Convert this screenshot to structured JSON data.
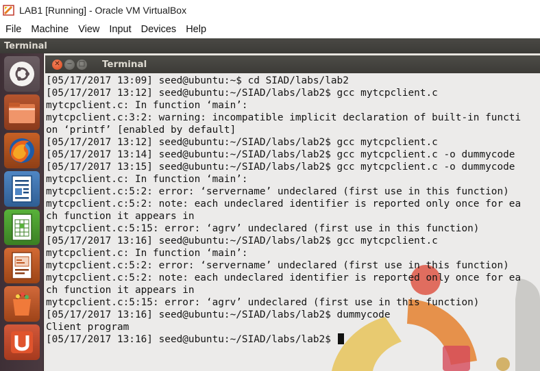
{
  "host": {
    "window_title": "LAB1 [Running] - Oracle VM VirtualBox",
    "menu": [
      "File",
      "Machine",
      "View",
      "Input",
      "Devices",
      "Help"
    ]
  },
  "guest": {
    "panel_title": "Terminal",
    "launcher": [
      {
        "name": "ubuntu-dash-icon"
      },
      {
        "name": "files-icon"
      },
      {
        "name": "firefox-icon"
      },
      {
        "name": "libreoffice-writer-icon"
      },
      {
        "name": "libreoffice-calc-icon"
      },
      {
        "name": "libreoffice-impress-icon"
      },
      {
        "name": "software-center-icon"
      },
      {
        "name": "ubuntu-one-icon"
      }
    ],
    "terminal": {
      "title": "Terminal",
      "lines": [
        "[05/17/2017 13:09] seed@ubuntu:~$ cd SIAD/labs/lab2",
        "[05/17/2017 13:12] seed@ubuntu:~/SIAD/labs/lab2$ gcc mytcpclient.c",
        "mytcpclient.c: In function ‘main’:",
        "mytcpclient.c:3:2: warning: incompatible implicit declaration of built-in functi",
        "on ‘printf’ [enabled by default]",
        "[05/17/2017 13:12] seed@ubuntu:~/SIAD/labs/lab2$ gcc mytcpclient.c",
        "[05/17/2017 13:14] seed@ubuntu:~/SIAD/labs/lab2$ gcc mytcpclient.c -o dummycode",
        "[05/17/2017 13:15] seed@ubuntu:~/SIAD/labs/lab2$ gcc mytcpclient.c -o dummycode",
        "mytcpclient.c: In function ‘main’:",
        "mytcpclient.c:5:2: error: ‘servername’ undeclared (first use in this function)",
        "mytcpclient.c:5:2: note: each undeclared identifier is reported only once for ea",
        "ch function it appears in",
        "mytcpclient.c:5:15: error: ‘agrv’ undeclared (first use in this function)",
        "[05/17/2017 13:16] seed@ubuntu:~/SIAD/labs/lab2$ gcc mytcpclient.c",
        "mytcpclient.c: In function ‘main’:",
        "mytcpclient.c:5:2: error: ‘servername’ undeclared (first use in this function)",
        "mytcpclient.c:5:2: note: each undeclared identifier is reported only once for ea",
        "ch function it appears in",
        "mytcpclient.c:5:15: error: ‘agrv’ undeclared (first use in this function)",
        "[05/17/2017 13:16] seed@ubuntu:~/SIAD/labs/lab2$ dummycode",
        "Client program",
        "[05/17/2017 13:16] seed@ubuntu:~/SIAD/labs/lab2$ "
      ]
    }
  },
  "colors": {
    "panel": "#3c3b37",
    "launcher": "#45363c",
    "terminal_bg": "#ecebea",
    "terminal_fg": "#141414",
    "close_button": "#e05a2b"
  }
}
